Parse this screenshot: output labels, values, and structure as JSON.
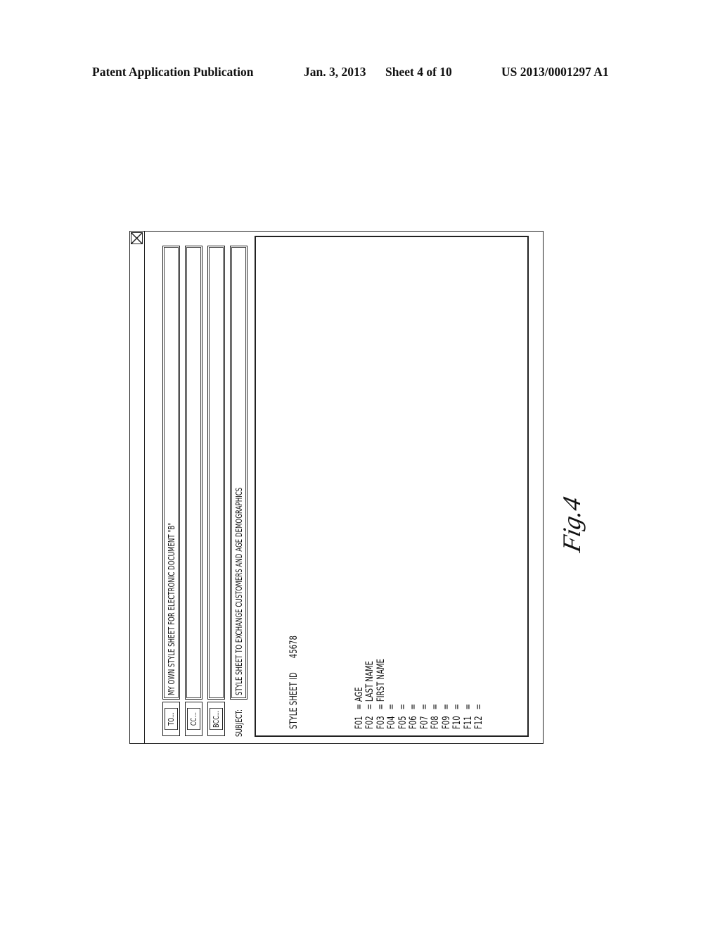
{
  "header": {
    "publication": "Patent Application Publication",
    "date": "Jan. 3, 2013",
    "sheet": "Sheet 4 of 10",
    "number": "US 2013/0001297 A1"
  },
  "dialog": {
    "close_icon": "close-box-icon",
    "buttons": {
      "to": "TO...",
      "cc": "CC...",
      "bcc": "BCC..."
    },
    "subject_label": "SUBJECT:",
    "fields": {
      "to": "MY OWN STYLE SHEET FOR ELECTRONIC DOCUMENT \"B\"",
      "cc": "",
      "bcc": "",
      "subject": "STYLE SHEET TO EXCHANGE CUSTOMERS AND AGE DEMOGRAPHICS"
    },
    "body": {
      "style_sheet_label": "STYLE SHEET ID",
      "style_sheet_id": "45678",
      "fields": [
        {
          "code": "F01",
          "eq": "=",
          "value": "AGE"
        },
        {
          "code": "F02",
          "eq": "=",
          "value": "LAST NAME"
        },
        {
          "code": "F03",
          "eq": "=",
          "value": "FIRST NAME"
        },
        {
          "code": "F04",
          "eq": "=",
          "value": ""
        },
        {
          "code": "F05",
          "eq": "=",
          "value": ""
        },
        {
          "code": "F06",
          "eq": "=",
          "value": ""
        },
        {
          "code": "F07",
          "eq": "=",
          "value": ""
        },
        {
          "code": "F08",
          "eq": "=",
          "value": ""
        },
        {
          "code": "F09",
          "eq": "=",
          "value": ""
        },
        {
          "code": "F10",
          "eq": "=",
          "value": ""
        },
        {
          "code": "F11",
          "eq": "=",
          "value": ""
        },
        {
          "code": "F12",
          "eq": "=",
          "value": ""
        }
      ]
    }
  },
  "figure_label": "Fig.4"
}
